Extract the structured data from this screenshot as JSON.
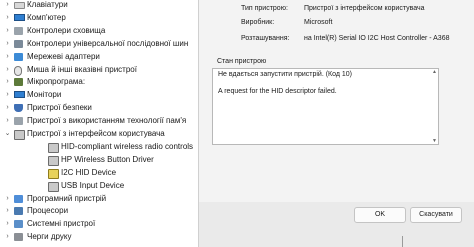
{
  "tree": {
    "items": [
      {
        "label": "Клавіатури",
        "icon": "keyboard-icon",
        "expander": "›",
        "indent": 0
      },
      {
        "label": "Комп'ютер",
        "icon": "monitor-icon",
        "expander": "›",
        "indent": 0
      },
      {
        "label": "Контролери сховища",
        "icon": "disk-icon",
        "expander": "›",
        "indent": 0
      },
      {
        "label": "Контролери універсальної послідовної шин",
        "icon": "usb-icon",
        "expander": "›",
        "indent": 0
      },
      {
        "label": "Мережеві адаптери",
        "icon": "network-icon",
        "expander": "›",
        "indent": 0
      },
      {
        "label": "Миша й інші вказівні пристрої",
        "icon": "mouse-icon",
        "expander": "›",
        "indent": 0
      },
      {
        "label": "Мікропрограма:",
        "icon": "chip-icon",
        "expander": "›",
        "indent": 0
      },
      {
        "label": "Монітори",
        "icon": "monitor-icon",
        "expander": "›",
        "indent": 0
      },
      {
        "label": "Пристрої безпеки",
        "icon": "shield-icon",
        "expander": "›",
        "indent": 0
      },
      {
        "label": "Пристрої з використанням технології пам'я",
        "icon": "disk-icon",
        "expander": "›",
        "indent": 0
      },
      {
        "label": "Пристрої з інтерфейсом користувача",
        "icon": "hid-icon",
        "expander": "⌄",
        "indent": 0
      },
      {
        "label": "HID-compliant wireless radio controls",
        "icon": "hid-icon",
        "expander": "",
        "indent": 1
      },
      {
        "label": "HP Wireless Button Driver",
        "icon": "hid-icon",
        "expander": "",
        "indent": 1
      },
      {
        "label": "I2C HID Device",
        "icon": "hid-warning-icon",
        "expander": "",
        "indent": 1
      },
      {
        "label": "USB Input Device",
        "icon": "hid-icon",
        "expander": "",
        "indent": 1
      },
      {
        "label": "Програмний пристрій",
        "icon": "app-icon",
        "expander": "›",
        "indent": 0
      },
      {
        "label": "Процесори",
        "icon": "cpu-icon",
        "expander": "›",
        "indent": 0
      },
      {
        "label": "Системні пристрої",
        "icon": "system-icon",
        "expander": "›",
        "indent": 0
      },
      {
        "label": "Черги друку",
        "icon": "printer-icon",
        "expander": "›",
        "indent": 0
      }
    ]
  },
  "dialog": {
    "properties": [
      {
        "key": "Тип пристрою:",
        "value": "Пристрої з інтерфейсом користувача"
      },
      {
        "key": "Виробник:",
        "value": "Microsoft"
      },
      {
        "key": "Розташування:",
        "value": "на Intel(R) Serial IO I2C Host Controller - A368"
      }
    ],
    "status_group_label": "Стан пристрою",
    "status_line1": "Не вдається запустити пристрій. (Код 10)",
    "status_line2": "A request for the HID descriptor failed.",
    "scroll_up_glyph": "▲",
    "scroll_down_glyph": "▼",
    "ok_label": "OK",
    "cancel_label": "Скасувати"
  }
}
